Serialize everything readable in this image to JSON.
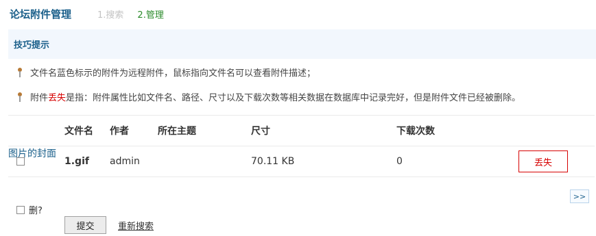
{
  "header": {
    "title": "论坛附件管理",
    "steps": [
      "1.搜索",
      "2.管理"
    ]
  },
  "tips": {
    "title": "技巧提示",
    "tip1": "文件名蓝色标示的附件为远程附件，鼠标指向文件名可以查看附件描述；",
    "tip2_prefix": "附件",
    "tip2_lost": "丢失",
    "tip2_suffix": "是指：附件属性比如文件名、路径、尺寸以及下载次数等相关数据在数据库中记录完好，但是附件文件已经被删除。"
  },
  "table": {
    "headers": {
      "file_name": "文件名",
      "author": "作者",
      "topic": "所在主题",
      "size": "尺寸",
      "downloads": "下载次数"
    },
    "rows": [
      {
        "file_name": "1.gif",
        "author": "admin",
        "topic": "图片的封面",
        "size": "70.11 KB",
        "downloads": "0",
        "status": "丢失"
      }
    ]
  },
  "pagination": {
    "next": ">>"
  },
  "form": {
    "delete_label": "删?",
    "submit_label": "提交",
    "research_label": "重新搜索"
  },
  "colors": {
    "title_blue": "#1a5f8a",
    "step_active": "#2a8a2a",
    "lost_red": "#d60000",
    "tips_bg": "#f2f7fd"
  }
}
